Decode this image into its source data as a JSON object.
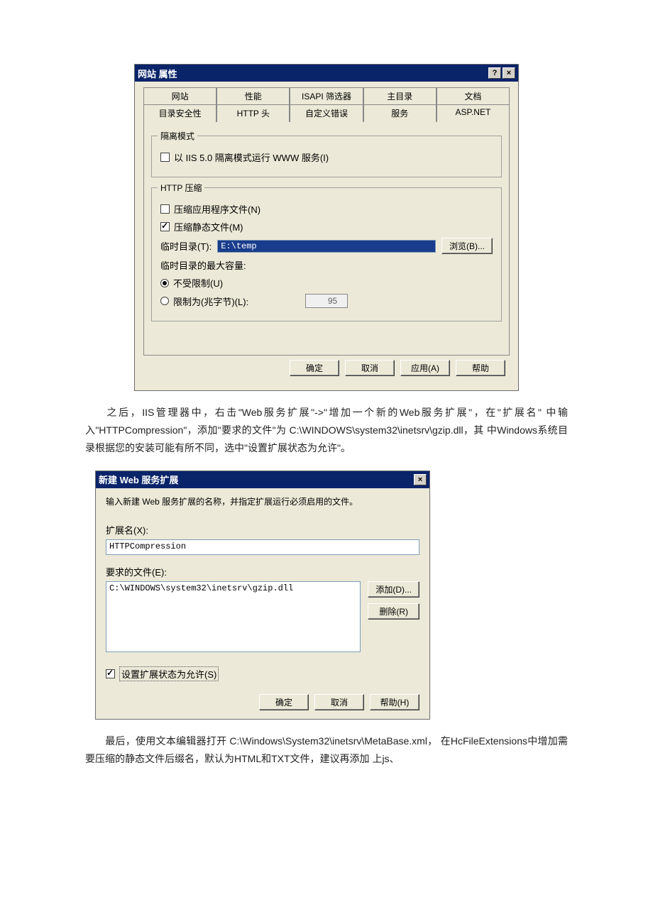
{
  "dialog1": {
    "title": "网站 属性",
    "help_icon": "?",
    "close_icon": "×",
    "tabs_back": [
      "网站",
      "性能",
      "ISAPI 筛选器",
      "主目录",
      "文档"
    ],
    "tabs_front": [
      "目录安全性",
      "HTTP 头",
      "自定义错误",
      "服务",
      "ASP.NET"
    ],
    "active_tab": "服务",
    "group_isolation": {
      "title": "隔离模式",
      "check_label": "以 IIS 5.0 隔离模式运行 WWW 服务(I)"
    },
    "group_compress": {
      "title": "HTTP 压缩",
      "check_app": "压缩应用程序文件(N)",
      "check_static": "压缩静态文件(M)",
      "temp_label": "临时目录(T):",
      "temp_value": "E:\\temp",
      "browse_btn": "浏览(B)...",
      "maxsize_label": "临时目录的最大容量:",
      "radio_unlimited": "不受限制(U)",
      "radio_limited": "限制为(兆字节)(L):",
      "limit_value": "95"
    },
    "buttons": {
      "ok": "确定",
      "cancel": "取消",
      "apply": "应用(A)",
      "help": "帮助"
    }
  },
  "para1": "之后，IIS管理器中，右击\"Web服务扩展\"->\"增加一个新的Web服务扩展\"，在\"扩展名\" 中输入\"HTTPCompression\"，添加\"要求的文件\"为 C:\\WINDOWS\\system32\\inetsrv\\gzip.dll，其 中Windows系统目录根据您的安装可能有所不同，选中\"设置扩展状态为允许\"。",
  "dialog2": {
    "title": "新建 Web 服务扩展",
    "close_icon": "×",
    "instruction": "输入新建 Web 服务扩展的名称，并指定扩展运行必须启用的文件。",
    "ext_label": "扩展名(X):",
    "ext_value": "HTTPCompression",
    "files_label": "要求的文件(E):",
    "file_item": "C:\\WINDOWS\\system32\\inetsrv\\gzip.dll",
    "add_btn": "添加(D)...",
    "remove_btn": "删除(R)",
    "allow_label": "设置扩展状态为允许(S)",
    "buttons": {
      "ok": "确定",
      "cancel": "取消",
      "help": "帮助(H)"
    }
  },
  "para2": "最后，使用文本编辑器打开 C:\\Windows\\System32\\inetsrv\\MetaBase.xml， 在HcFileExtensions中增加需要压缩的静态文件后缀名，默认为HTML和TXT文件，建议再添加 上js、"
}
